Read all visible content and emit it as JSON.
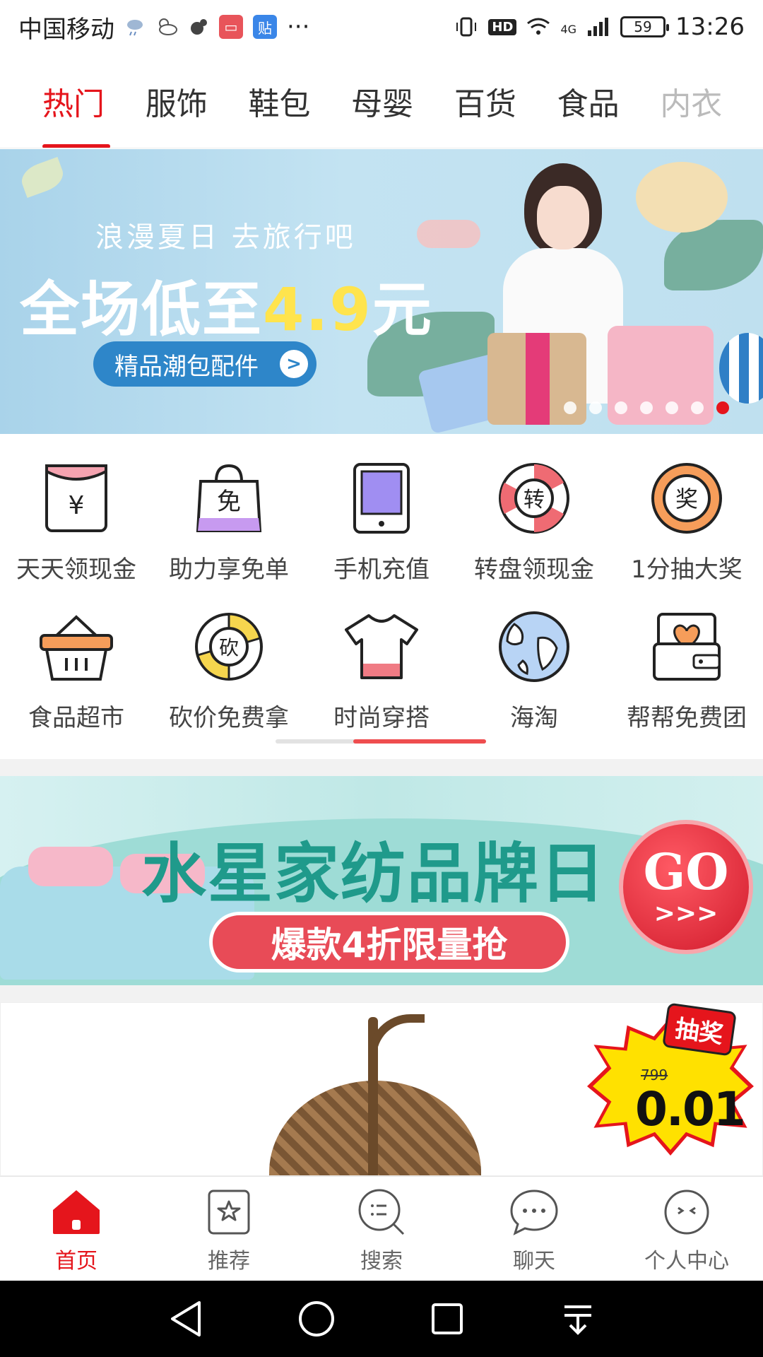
{
  "status_bar": {
    "carrier": "中国移动",
    "extra_icons": "···",
    "network": "4G",
    "hd": "HD",
    "battery": "59",
    "time": "13:26"
  },
  "tabs": [
    {
      "label": "热门",
      "active": true
    },
    {
      "label": "服饰"
    },
    {
      "label": "鞋包"
    },
    {
      "label": "母婴"
    },
    {
      "label": "百货"
    },
    {
      "label": "食品"
    },
    {
      "label": "内衣"
    }
  ],
  "hero_banner": {
    "subtitle": "浪漫夏日 去旅行吧",
    "headline_prefix": "全场低至",
    "headline_number": "4.9",
    "headline_suffix": "元",
    "pill_label": "精品潮包配件",
    "pill_arrow": ">",
    "slide_count": 7,
    "active_slide": 7
  },
  "grid": {
    "row1": [
      {
        "label": "天天领现金",
        "icon": "red-envelope-icon",
        "glyph": "¥"
      },
      {
        "label": "助力享免单",
        "icon": "shopping-bag-free-icon",
        "glyph": "免"
      },
      {
        "label": "手机充值",
        "icon": "tablet-icon"
      },
      {
        "label": "转盘领现金",
        "icon": "wheel-icon",
        "glyph": "转"
      },
      {
        "label": "1分抽大奖",
        "icon": "prize-icon",
        "glyph": "奖"
      }
    ],
    "row2": [
      {
        "label": "食品超市",
        "icon": "basket-icon"
      },
      {
        "label": "砍价免费拿",
        "icon": "bargain-icon",
        "glyph": "砍"
      },
      {
        "label": "时尚穿搭",
        "icon": "tshirt-icon"
      },
      {
        "label": "海淘",
        "icon": "globe-icon"
      },
      {
        "label": "帮帮免费团",
        "icon": "wallet-heart-icon"
      }
    ]
  },
  "promo_banner": {
    "title": "水星家纺品牌日",
    "cta": "爆款4折限量抢",
    "go": "GO",
    "go_arrows": ">>>"
  },
  "product_card": {
    "tag": "抽奖",
    "old_price": "799",
    "price": "0.01"
  },
  "bottom_nav": [
    {
      "label": "首页",
      "icon": "home-icon",
      "active": true
    },
    {
      "label": "推荐",
      "icon": "recommend-icon"
    },
    {
      "label": "搜索",
      "icon": "search-icon"
    },
    {
      "label": "聊天",
      "icon": "chat-icon"
    },
    {
      "label": "个人中心",
      "icon": "profile-icon"
    }
  ],
  "colors": {
    "accent": "#e5151c",
    "promo_teal": "#1f9a8b",
    "price_burst": "#ffe100"
  }
}
